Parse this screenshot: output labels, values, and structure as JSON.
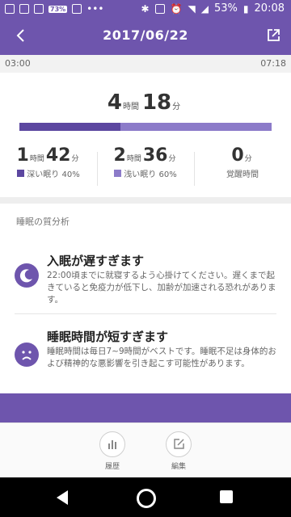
{
  "status_bar": {
    "badge": "73%",
    "battery": "53%",
    "time": "20:08"
  },
  "header": {
    "date": "2017/06/22"
  },
  "timeline": {
    "start": "03:00",
    "end": "07:18"
  },
  "total": {
    "hours": "4",
    "hours_unit": "時間",
    "minutes": "18",
    "minutes_unit": "分"
  },
  "sleep_bar": {
    "deep_fraction": 0.4,
    "light_fraction": 0.6,
    "deep_color": "#5c47a0",
    "light_color": "#8c7bc9"
  },
  "stats": [
    {
      "hours": "1",
      "hours_unit": "時間",
      "minutes": "42",
      "minutes_unit": "分",
      "label": "深い眠り 40%",
      "color": "#5c47a0"
    },
    {
      "hours": "2",
      "hours_unit": "時間",
      "minutes": "36",
      "minutes_unit": "分",
      "label": "浅い眠り 60%",
      "color": "#8c7bc9"
    },
    {
      "minutes": "0",
      "minutes_unit": "分",
      "label": "覚醒時間"
    }
  ],
  "analysis": {
    "title": "睡眠の質分析",
    "items": [
      {
        "icon": "moon-icon",
        "heading": "入眠が遅すぎます",
        "text": "22:00頃までに就寝するよう心掛けてください。遅くまで起きていると免疫力が低下し、加齢が加速される恐れがあります。"
      },
      {
        "icon": "sad-face-icon",
        "heading": "睡眠時間が短すぎます",
        "text": "睡眠時間は毎日7~9時間がベストです。睡眠不足は身体的および精神的な悪影響を引き起こす可能性があります。"
      }
    ]
  },
  "bottom": {
    "history_label": "履歴",
    "edit_label": "編集"
  },
  "colors": {
    "accent": "#6e55ad"
  }
}
